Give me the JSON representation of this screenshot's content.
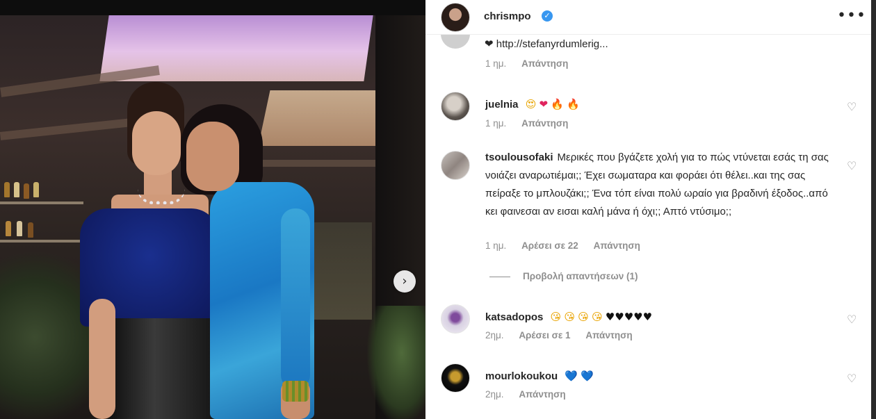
{
  "post": {
    "author": "chrismpo",
    "verified_mark": "✓",
    "more_glyph": "•••",
    "next_glyph": "›"
  },
  "partial_comment": {
    "text": "❤ http://stefanyrdumlerig..."
  },
  "partial_meta": {
    "time": "1 ημ.",
    "reply": "Απάντηση"
  },
  "comments": [
    {
      "username": "juelnia",
      "emojis": [
        "😍",
        "❤",
        "🔥",
        "🔥"
      ],
      "time": "1 ημ.",
      "likes": "",
      "reply": "Απάντηση"
    },
    {
      "username": "tsoulousofaki",
      "text": "Μερικές που βγάζετε χολή για το πώς ντύνεται εσάς τη σας νοιάζει αναρωτιέμαι;; Έχει σωματαρα και φοράει ότι θέλει..και της σας πείραξε το μπλουζάκι;; Ένα τόπ είναι πολύ ωραίο για βραδινή έξοδος..από κει φαινεσαι αν εισαι καλή μάνα ή όχι;; Απτό ντύσιμο;;",
      "time": "1 ημ.",
      "likes": "Αρέσει σε 22",
      "reply": "Απάντηση",
      "view_replies": "Προβολή απαντήσεων (1)"
    },
    {
      "username": "katsadopos",
      "emojis": [
        "😘",
        "😘",
        "😘",
        "😘",
        "♥",
        "♥",
        "♥",
        "♥",
        "♥"
      ],
      "time": "2ημ.",
      "likes": "Αρέσει σε 1",
      "reply": "Απάντηση"
    },
    {
      "username": "mourlokoukou",
      "emojis": [
        "💙",
        "💙"
      ],
      "time": "2ημ.",
      "likes": "",
      "reply": "Απάντηση"
    }
  ],
  "icons": {
    "like": "♡"
  },
  "colors": {
    "verified": "#3897f0",
    "text": "#262626",
    "muted": "#8e8e8e",
    "dress_left": "#0d1656",
    "dress_right": "#2b9fe0"
  }
}
